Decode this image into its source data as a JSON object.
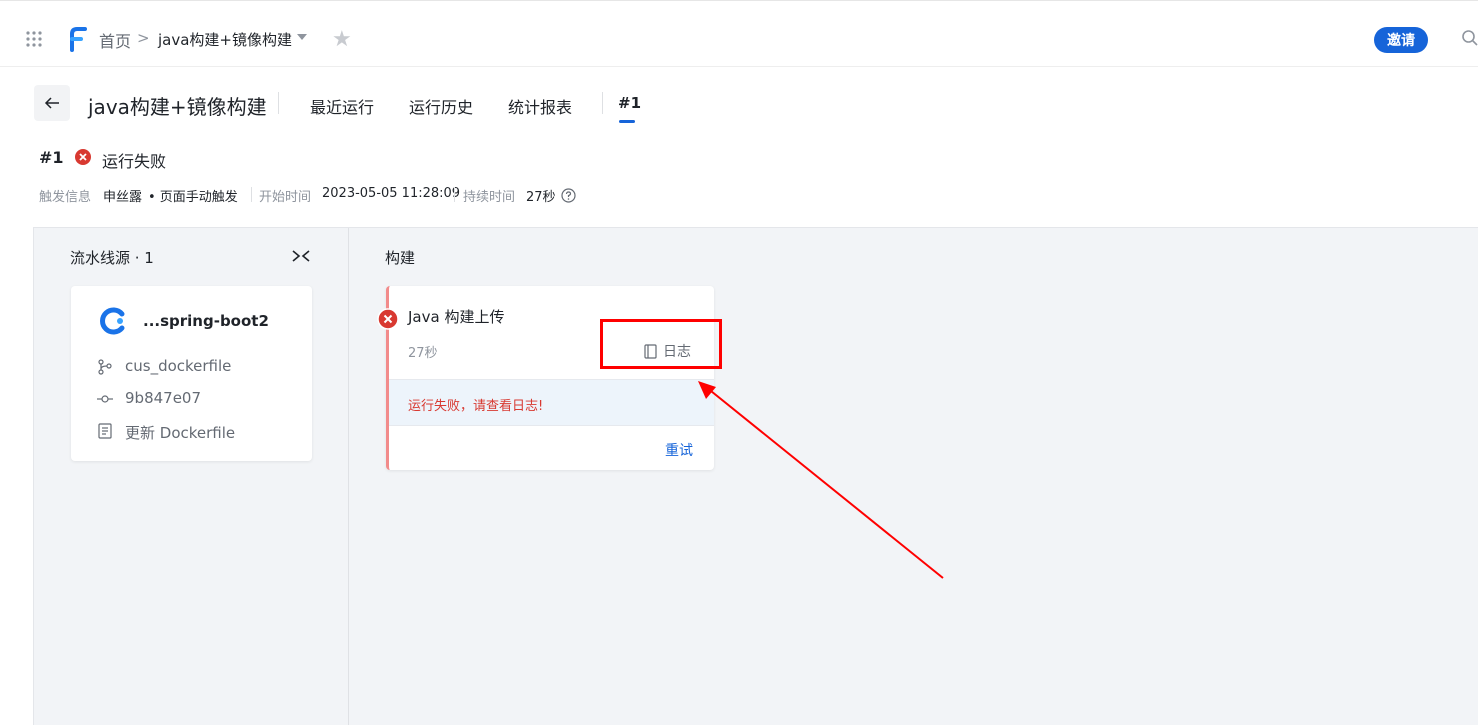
{
  "header": {
    "home_label": "首页",
    "separator": ">",
    "current_project": "java构建+镜像构建",
    "invite_label": "邀请"
  },
  "pipeline": {
    "title": "java构建+镜像构建",
    "tabs": [
      {
        "label": "最近运行"
      },
      {
        "label": "运行历史"
      },
      {
        "label": "统计报表"
      },
      {
        "label": "#1",
        "active": true
      }
    ]
  },
  "run": {
    "number": "#1",
    "status": "运行失败",
    "trigger_label": "触发信息",
    "trigger_user": "申丝露",
    "trigger_mode": "• 页面手动触发",
    "start_label": "开始时间",
    "start_time": "2023-05-05 11:28:09",
    "duration_label": "持续时间",
    "duration": "27秒"
  },
  "source": {
    "title": "流水线源 · 1",
    "repo": "...spring-boot2",
    "branch": "cus_dockerfile",
    "commit": "9b847e07",
    "message": "更新 Dockerfile"
  },
  "build": {
    "stage_title": "构建",
    "job_name": "Java 构建上传",
    "job_duration": "27秒",
    "log_label": "日志",
    "error_message": "运行失败，请查看日志!",
    "retry_label": "重试"
  },
  "colors": {
    "accent": "#1664d9",
    "error": "#d83931",
    "annotation": "#ff0000"
  }
}
